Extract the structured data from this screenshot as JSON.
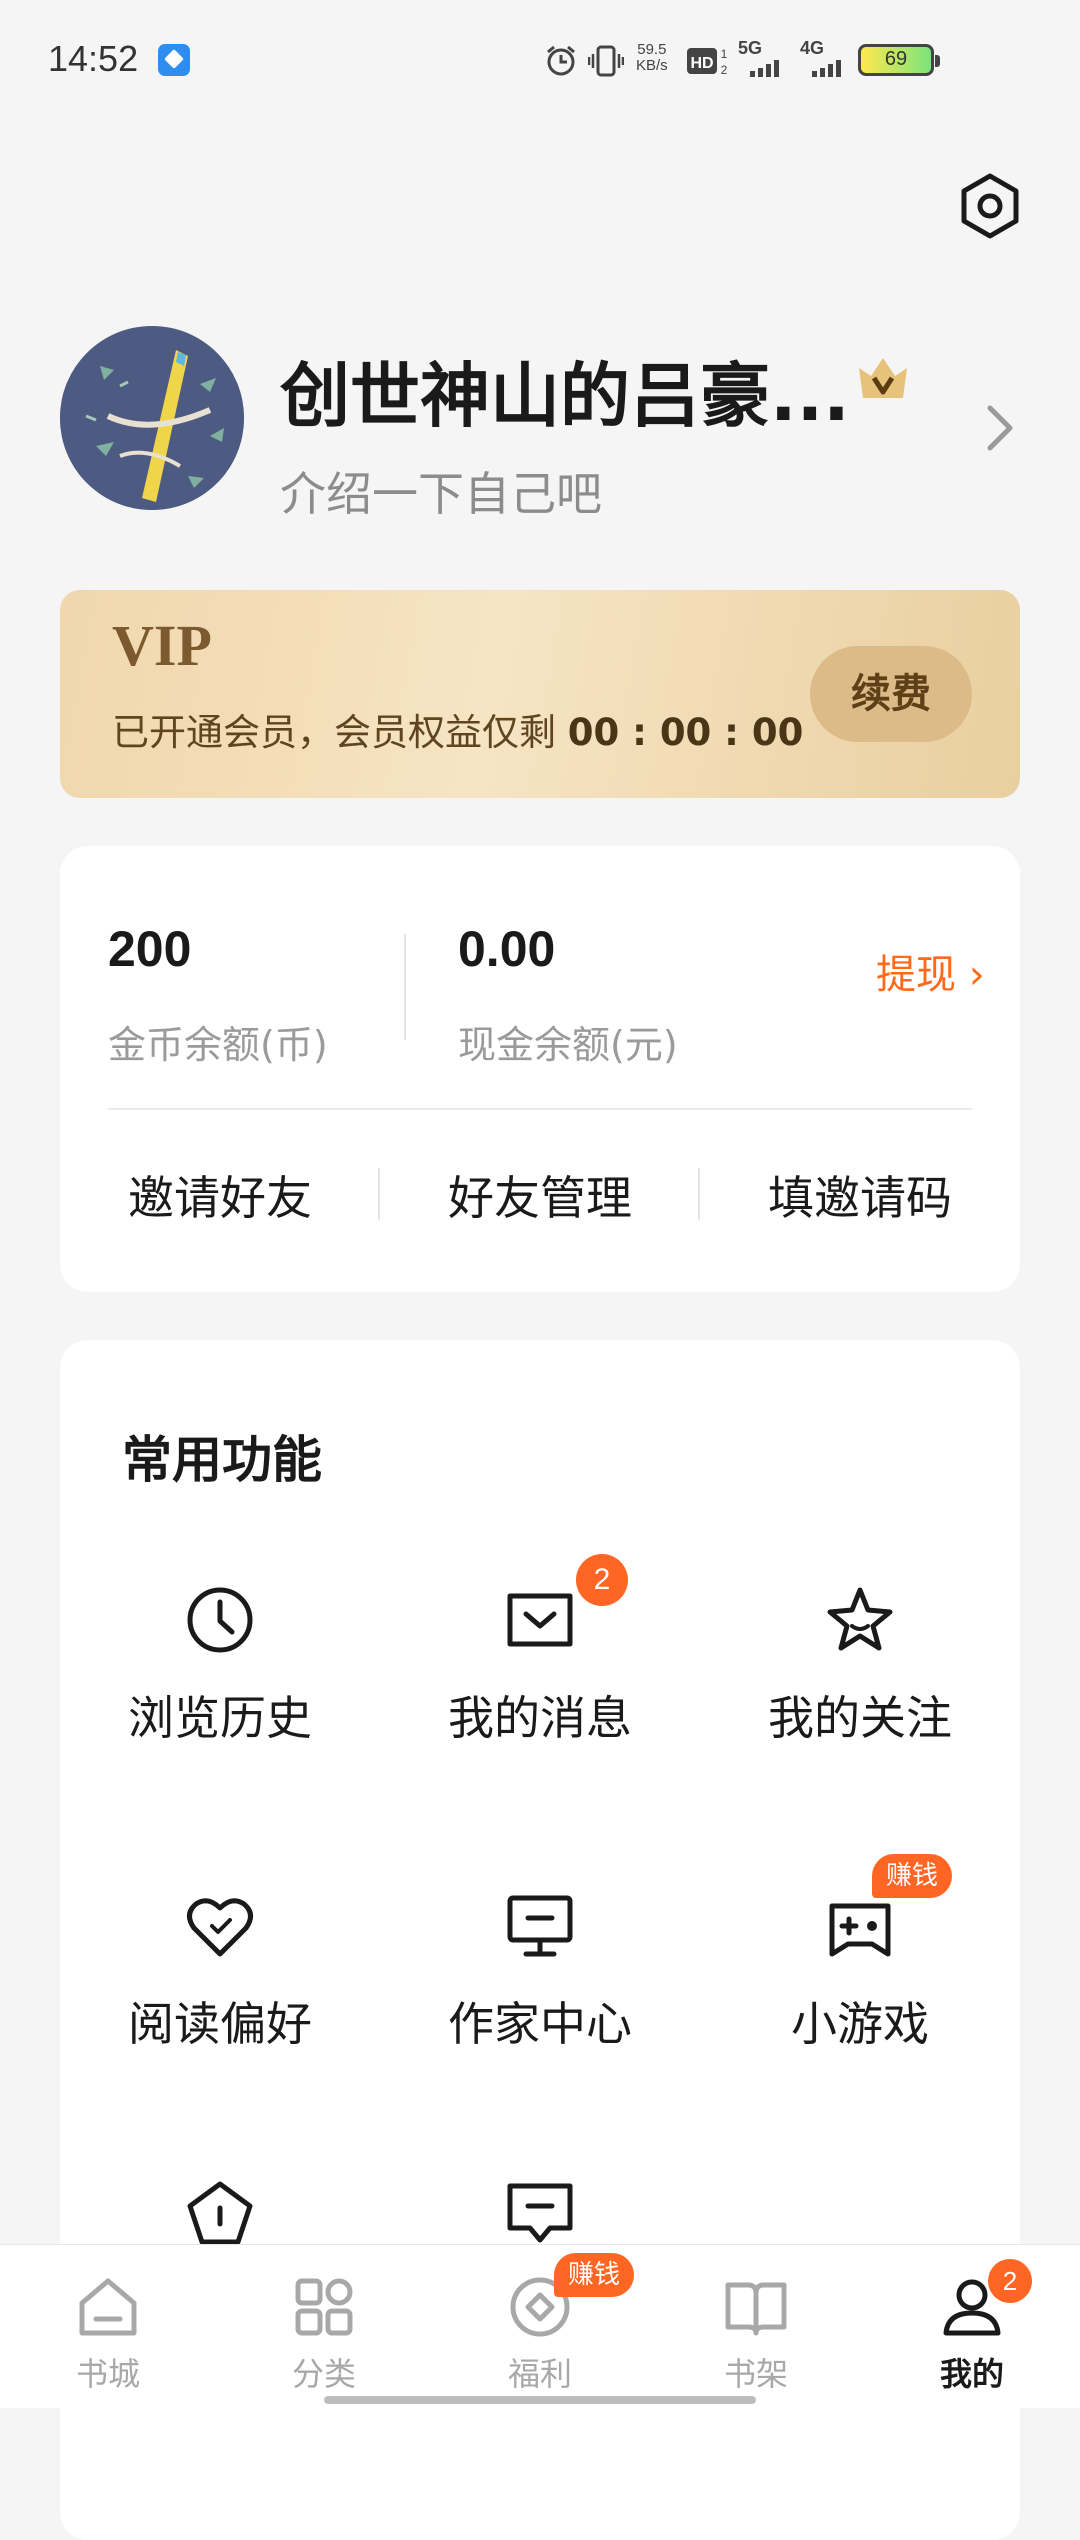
{
  "status_bar": {
    "time": "14:52",
    "net_speed_value": "59.5",
    "net_speed_unit": "KB/s",
    "sim1_network": "5G",
    "sim2_network": "4G",
    "battery": "69"
  },
  "profile": {
    "name": "创世神山的吕豪...",
    "bio": "介绍一下自己吧"
  },
  "vip": {
    "title": "VIP",
    "description": "已开通会员，会员权益仅剩 ",
    "countdown": "00 : 00 : 00",
    "renew_label": "续费"
  },
  "wallet": {
    "coin_balance": "200",
    "coin_label": "金币余额(币)",
    "cash_balance": "0.00",
    "cash_label": "现金余额(元)",
    "withdraw_label": "提现 ›",
    "links": [
      "邀请好友",
      "好友管理",
      "填邀请码"
    ]
  },
  "functions": {
    "title": "常用功能",
    "items": [
      {
        "label": "浏览历史",
        "icon": "clock-icon"
      },
      {
        "label": "我的消息",
        "icon": "message-icon",
        "badge": "2"
      },
      {
        "label": "我的关注",
        "icon": "star-icon"
      },
      {
        "label": "阅读偏好",
        "icon": "heart-icon"
      },
      {
        "label": "作家中心",
        "icon": "monitor-icon"
      },
      {
        "label": "小游戏",
        "icon": "gamepad-icon",
        "badge": "赚钱"
      }
    ]
  },
  "bottom_nav": {
    "items": [
      {
        "label": "书城",
        "icon": "home-icon"
      },
      {
        "label": "分类",
        "icon": "grid-icon"
      },
      {
        "label": "福利",
        "icon": "coin-icon",
        "badge": "赚钱"
      },
      {
        "label": "书架",
        "icon": "book-icon"
      },
      {
        "label": "我的",
        "icon": "profile-icon",
        "badge": "2",
        "active": true
      }
    ]
  },
  "colors": {
    "accent": "#ff6624",
    "vip_gold": "#dcbb88",
    "background": "#f5f5f5"
  }
}
